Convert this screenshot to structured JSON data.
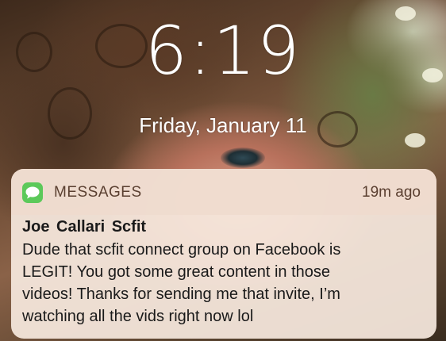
{
  "lockscreen": {
    "time": "6:19",
    "date": "Friday, January 11"
  },
  "notification": {
    "app_icon": "messages-bubble-icon",
    "app_name": "MESSAGES",
    "timestamp": "19m ago",
    "sender": "Joe  Callari Scfit",
    "message": "Dude that scfit connect group on Facebook is\nLEGIT! You got some great content in those\nvideos! Thanks for sending me that invite, I’m\nwatching all the vids right now lol"
  },
  "colors": {
    "messages_green": "#5cc95a",
    "notification_background": "#f6e8de"
  }
}
